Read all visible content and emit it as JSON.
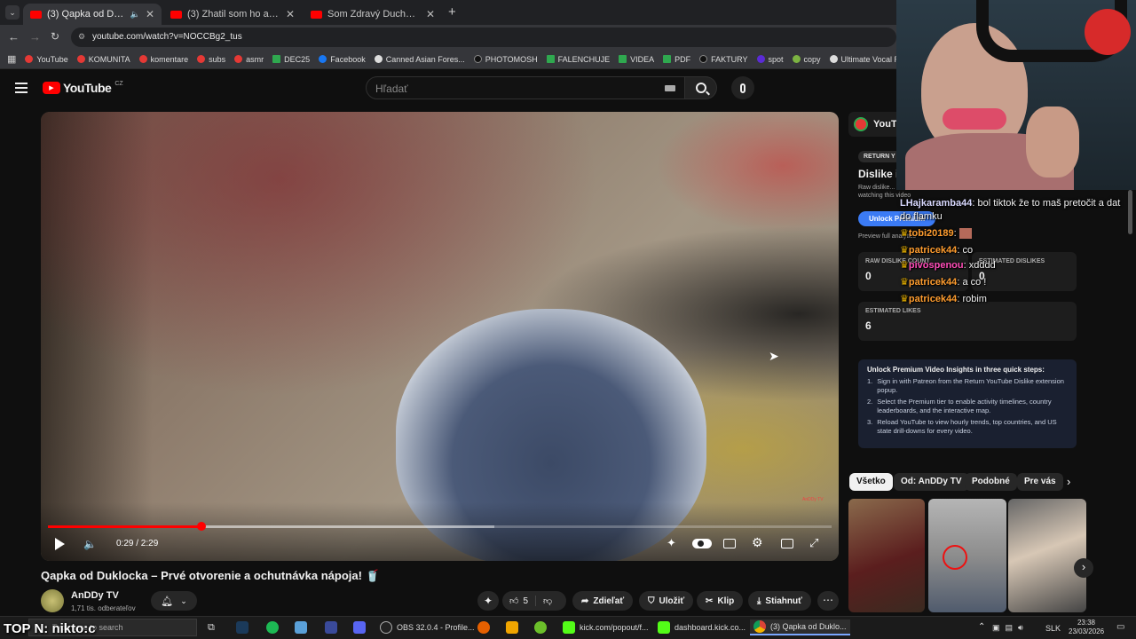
{
  "browser": {
    "tabs": [
      {
        "title": "(3) Qapka od Duklocka – P",
        "active": true
      },
      {
        "title": "(3) Zhatil som ho ako psa, on m",
        "active": false
      },
      {
        "title": "Som Zdravý Duchovný svet vs d",
        "active": false
      }
    ],
    "new_tab_icon": "plus",
    "url": "youtube.com/watch?v=NOCCBg2_tus",
    "bookmarks": [
      "YouTube",
      "KOMUNITA",
      "komentare",
      "subs",
      "asmr",
      "DEC25",
      "Facebook",
      "Canned Asian Fores...",
      "PHOTOMOSH",
      "FALENCHUJE",
      "VIDEA",
      "PDF",
      "FAKTURY",
      "spot",
      "copy",
      "Ultimate Vocal Rem..."
    ]
  },
  "youtube": {
    "logo": "YouTube",
    "country": "CZ",
    "search_placeholder": "Hľadať"
  },
  "player": {
    "time": "0:29 / 2:29",
    "progress": 0.196,
    "buffered": 0.57,
    "watermark": "AnDDy TV"
  },
  "video": {
    "title": "Qapka od Duklocka – Prvé otvorenie a ochutnávka nápoja! 🥤",
    "channel": "AnDDy TV",
    "subscribers": "1,71 tis. odberateľov",
    "likes": "5",
    "actions": {
      "share": "Zdieľať",
      "save": "Uložiť",
      "clip": "Klip",
      "download": "Stiahnuť"
    }
  },
  "rydpanel": {
    "header": "YouT",
    "badge": "RETURN Y",
    "title": "Dislike i",
    "desc": "Raw dislike... watching this video",
    "unlock_btn": "Unlock Premium",
    "preview": "Preview full analytics",
    "raw_label": "RAW DISLIKE COUNT",
    "raw_value": "0",
    "est_dislikes_label": "ESTIMATED DISLIKES",
    "est_dislikes_value": "0",
    "est_likes_label": "ESTIMATED LIKES",
    "est_likes_value": "6",
    "steps_title": "Unlock Premium Video Insights in three quick steps:",
    "steps": [
      "Sign in with Patreon from the Return YouTube Dislike extension popup.",
      "Select the Premium tier to enable activity timelines, country leaderboards, and the interactive map.",
      "Reload YouTube to view hourly trends, top countries, and US state drill-downs for every video."
    ]
  },
  "chips": [
    "Všetko",
    "Od: AnDDy TV",
    "Podobné",
    "Pre vás"
  ],
  "chat": [
    {
      "user": "LHajkaramba44",
      "msg": "bol tiktok že to maš pretočit a dat",
      "color": "#d9d9ff"
    },
    {
      "user": "",
      "msg": "do flamku",
      "color": "#ffffff"
    },
    {
      "user": "tobi20189",
      "msg": "",
      "color": "#ff9d2f"
    },
    {
      "user": "patricek44",
      "msg": "co",
      "color": "#ff9d2f"
    },
    {
      "user": "pivospenou",
      "msg": "xdddd",
      "color": "#ff4db8"
    },
    {
      "user": "patricek44",
      "msg": "a co !",
      "color": "#ff9d2f"
    },
    {
      "user": "patricek44",
      "msg": "robim",
      "color": "#ff9d2f"
    }
  ],
  "taskbar": {
    "overlay": "TOP N: nikto:c",
    "search_placeholder": "Type here to search",
    "items": [
      "OBS 32.0.4 - Profile...",
      "kick.com/popout/f...",
      "dashboard.kick.co...",
      "(3) Qapka od Duklo..."
    ],
    "lang": "SLK",
    "time": "23:38",
    "date": "23/03/2026"
  },
  "colors": {
    "accent": "#ff0000",
    "bg": "#0f0f0f",
    "link": "#3ea6ff"
  }
}
